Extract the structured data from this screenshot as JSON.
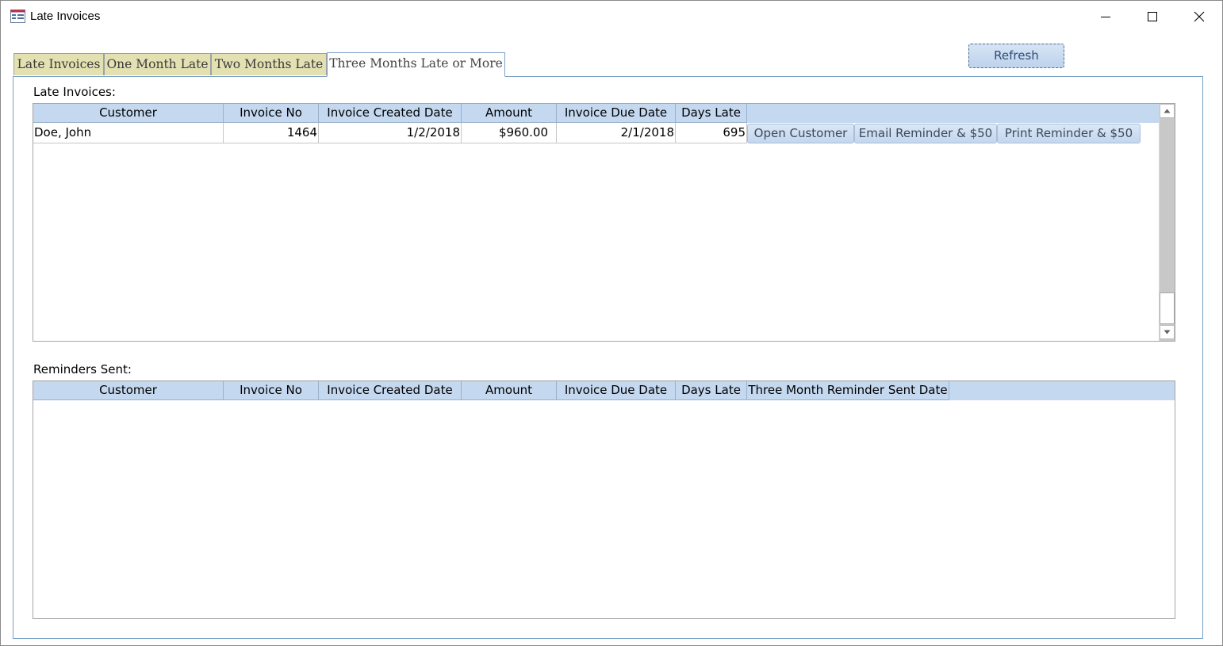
{
  "window": {
    "title": "Late Invoices",
    "icon": "form-icon"
  },
  "tabs": [
    {
      "label": "Late Invoices",
      "active": false
    },
    {
      "label": "One Month Late",
      "active": false
    },
    {
      "label": "Two Months Late",
      "active": false
    },
    {
      "label": "Three Months Late or More",
      "active": true
    }
  ],
  "toolbar": {
    "refresh_label": "Refresh"
  },
  "late_invoices": {
    "label": "Late Invoices:",
    "columns": [
      "Customer",
      "Invoice No",
      "Invoice Created Date",
      "Amount",
      "Invoice Due Date",
      "Days Late"
    ],
    "rows": [
      {
        "customer": "Doe, John",
        "invoice_no": "1464",
        "created": "1/2/2018",
        "amount": "$960.00",
        "due": "2/1/2018",
        "days_late": "695",
        "open_label": "Open Customer",
        "email_label": "Email Reminder & $50",
        "print_label": "Print Reminder & $50"
      }
    ]
  },
  "reminders_sent": {
    "label": "Reminders Sent:",
    "columns": [
      "Customer",
      "Invoice No",
      "Invoice Created Date",
      "Amount",
      "Invoice Due Date",
      "Days Late",
      "Three Month Reminder Sent Date"
    ]
  },
  "colors": {
    "header_bg": "#c4d8f0",
    "inactive_tab_bg": "#e3e1b2",
    "accent_border": "#7aa0c8"
  }
}
